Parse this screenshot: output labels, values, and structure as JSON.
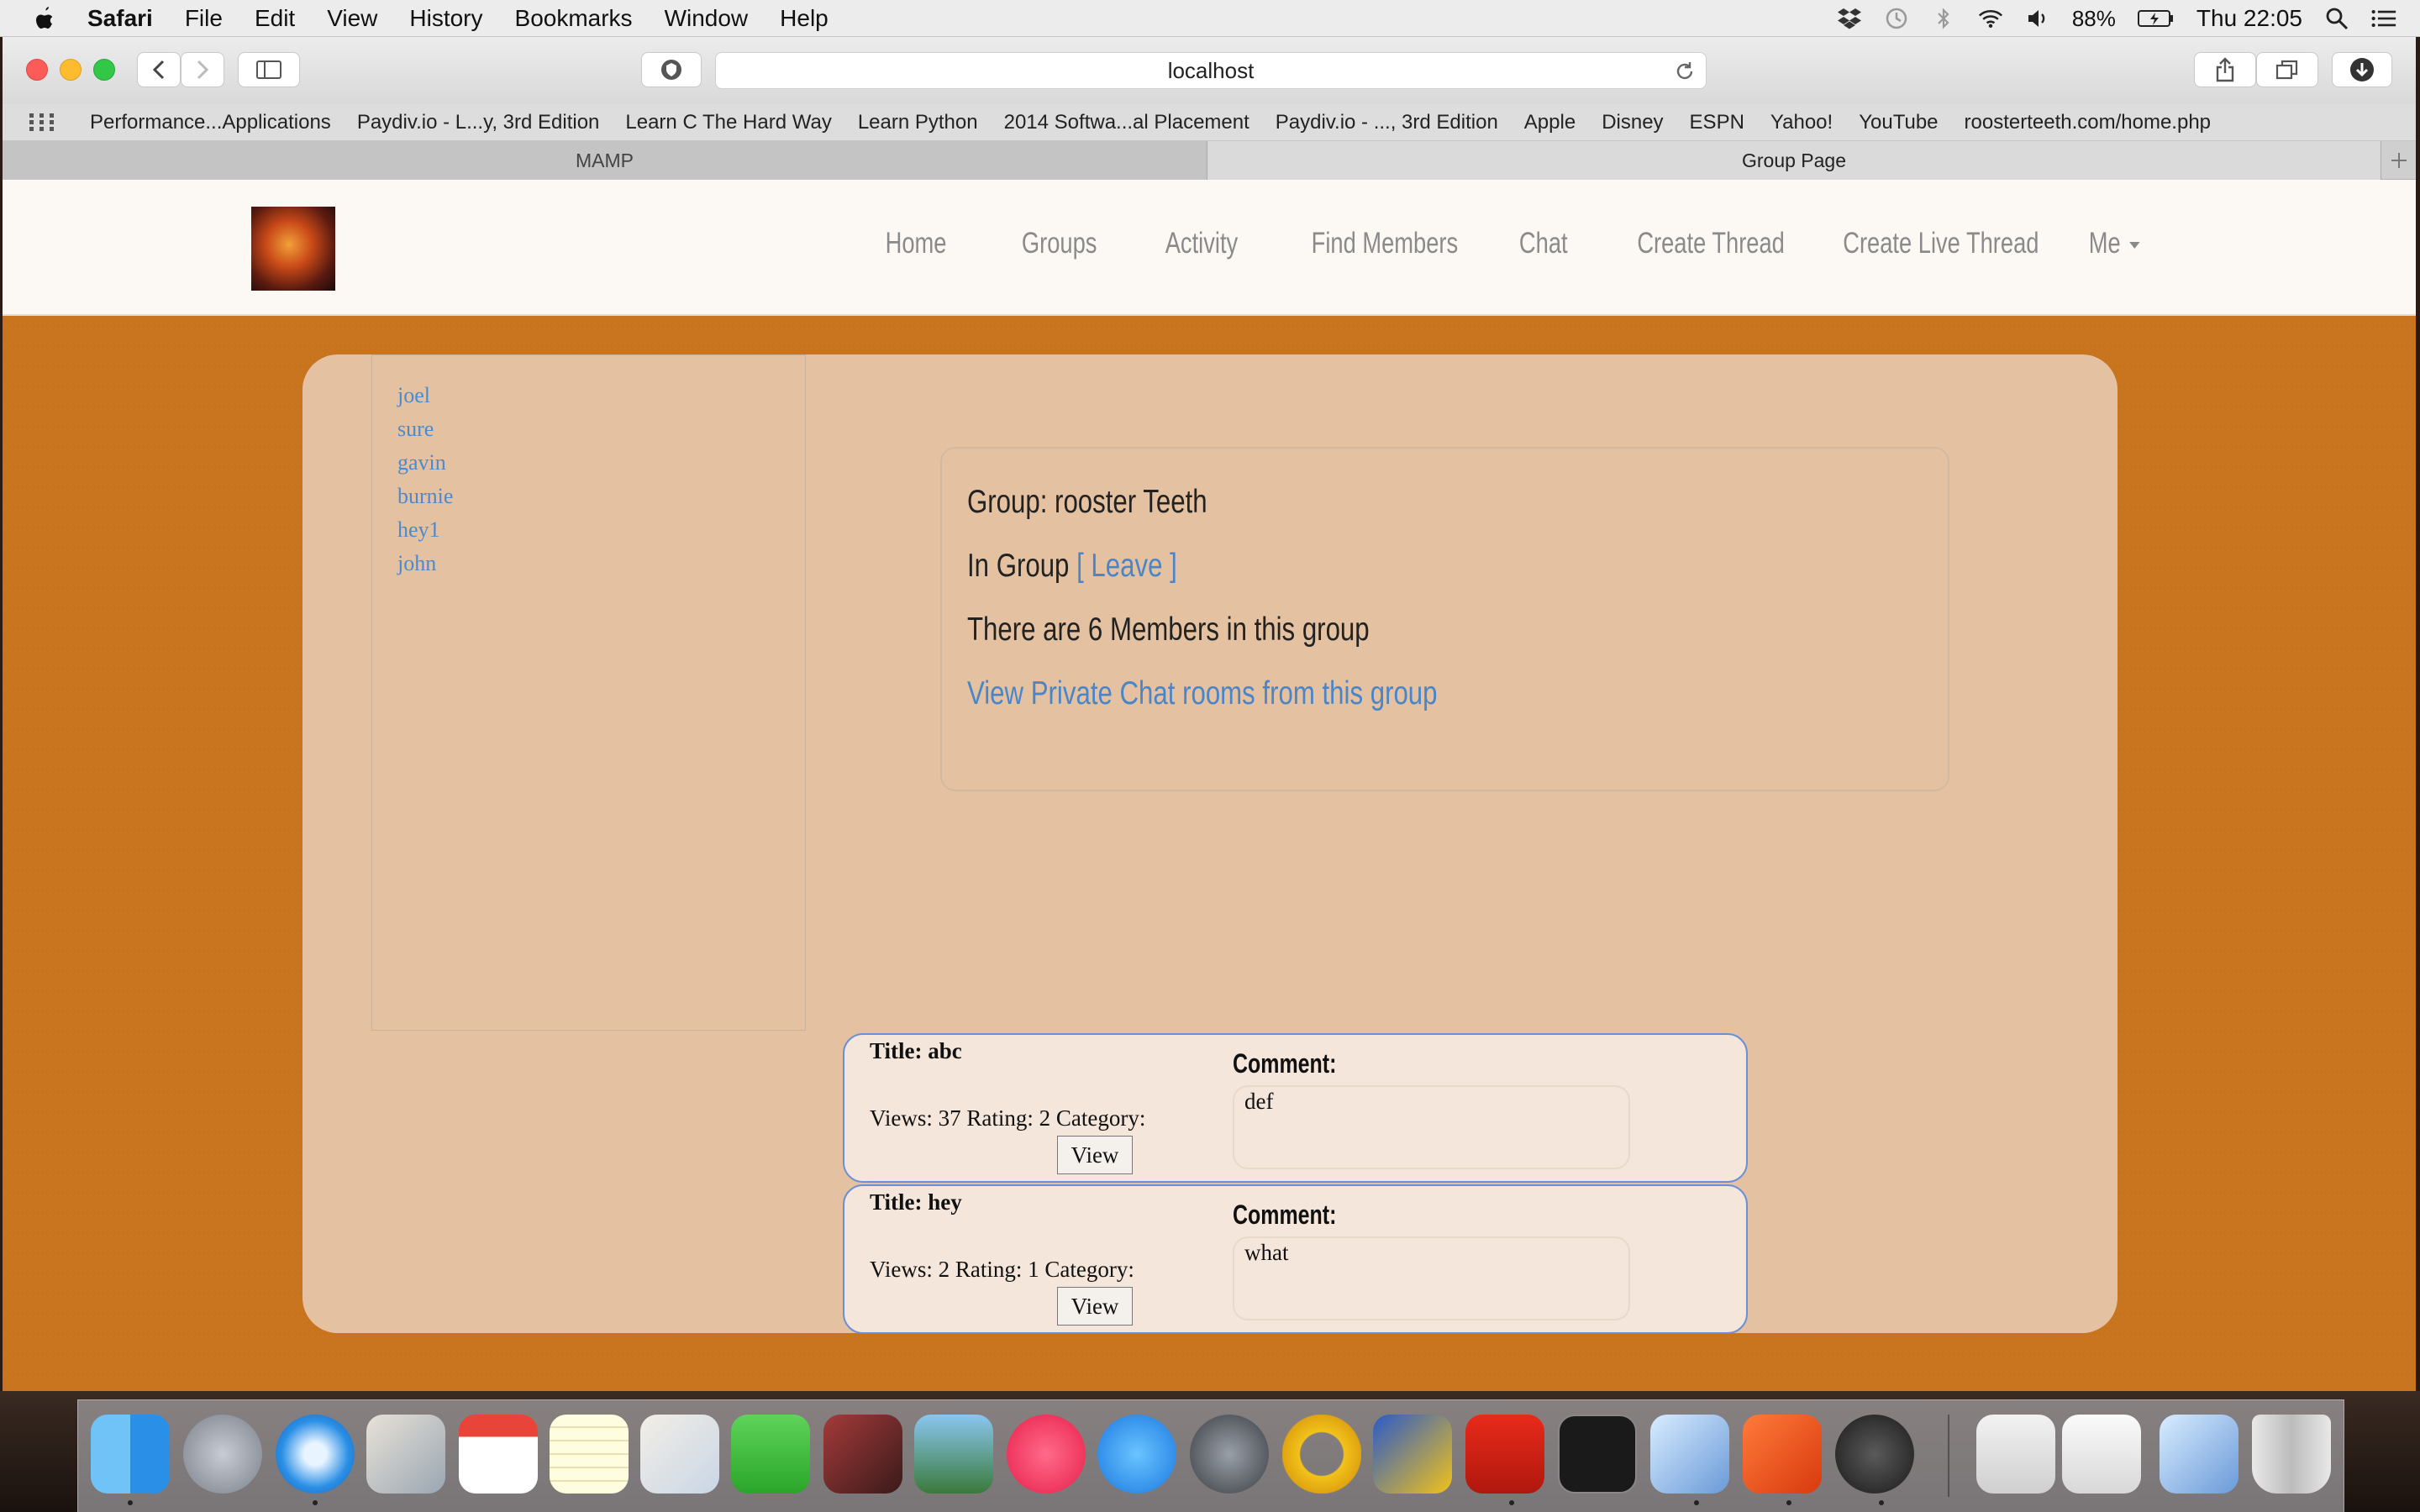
{
  "menubar": {
    "app": "Safari",
    "items": [
      "File",
      "Edit",
      "View",
      "History",
      "Bookmarks",
      "Window",
      "Help"
    ],
    "battery": "88%",
    "clock": "Thu 22:05"
  },
  "browser": {
    "url": "localhost",
    "bookmarks": [
      "Performance...Applications",
      "Paydiv.io - L...y, 3rd Edition",
      "Learn C The Hard Way",
      "Learn Python",
      "2014 Softwa...al Placement",
      "Paydiv.io - ..., 3rd Edition",
      "Apple",
      "Disney",
      "ESPN",
      "Yahoo!",
      "YouTube",
      "roosterteeth.com/home.php"
    ],
    "tabs": [
      "MAMP",
      "Group Page"
    ]
  },
  "nav": {
    "items": [
      "Home",
      "Groups",
      "Activity",
      "Find Members",
      "Chat",
      "Create Thread",
      "Create Live Thread",
      "Me"
    ]
  },
  "members": [
    "joel",
    "sure",
    "gavin",
    "burnie",
    "hey1",
    "john"
  ],
  "group": {
    "name_line": "Group: rooster Teeth",
    "status_prefix": "In Group",
    "leave_link": "[ Leave ]",
    "count_line": "There are 6 Members in this group",
    "chat_link": "View Private Chat rooms from this group"
  },
  "threads": [
    {
      "title": "Title: abc",
      "meta": "Views: 37 Rating: 2 Category:",
      "button": "View",
      "comment_label": "Comment:",
      "comment": "def"
    },
    {
      "title": "Title: hey",
      "meta": "Views: 2 Rating: 1 Category:",
      "button": "View",
      "comment_label": "Comment:",
      "comment": "what"
    }
  ]
}
